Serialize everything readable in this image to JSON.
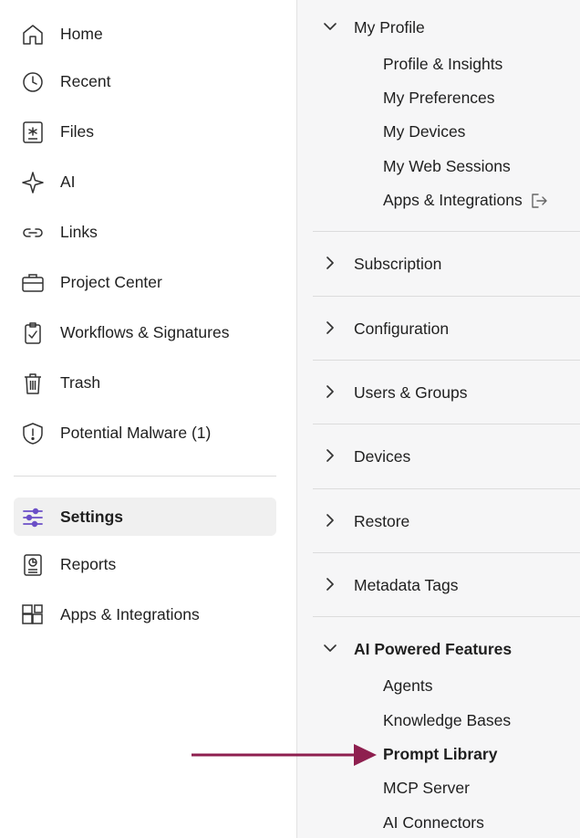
{
  "sidebar": {
    "items": [
      {
        "label": "Home",
        "icon": "home-icon"
      },
      {
        "label": "Recent",
        "icon": "clock-icon"
      },
      {
        "label": "Files",
        "icon": "files-icon"
      },
      {
        "label": "AI",
        "icon": "sparkle-icon"
      },
      {
        "label": "Links",
        "icon": "link-icon"
      },
      {
        "label": "Project Center",
        "icon": "briefcase-icon"
      },
      {
        "label": "Workflows & Signatures",
        "icon": "clipboard-check-icon"
      },
      {
        "label": "Trash",
        "icon": "trash-icon"
      },
      {
        "label": "Potential Malware (1)",
        "icon": "shield-alert-icon"
      }
    ],
    "bottom_items": [
      {
        "label": "Settings",
        "icon": "sliders-icon",
        "active": true
      },
      {
        "label": "Reports",
        "icon": "report-icon"
      },
      {
        "label": "Apps & Integrations",
        "icon": "apps-icon"
      }
    ]
  },
  "settings_menu": {
    "sections": [
      {
        "title": "My Profile",
        "expanded": true,
        "items": [
          "Profile & Insights",
          "My Preferences",
          "My Devices",
          "My Web Sessions",
          "Apps & Integrations"
        ]
      },
      {
        "title": "Subscription",
        "expanded": false
      },
      {
        "title": "Configuration",
        "expanded": false
      },
      {
        "title": "Users & Groups",
        "expanded": false
      },
      {
        "title": "Devices",
        "expanded": false
      },
      {
        "title": "Restore",
        "expanded": false
      },
      {
        "title": "Metadata Tags",
        "expanded": false
      },
      {
        "title": "AI Powered Features",
        "expanded": true,
        "items": [
          "Agents",
          "Knowledge Bases",
          "Prompt Library",
          "MCP Server",
          "AI Connectors"
        ],
        "highlighted_item": "Prompt Library"
      }
    ]
  },
  "colors": {
    "accent": "#6b4fc7",
    "arrow": "#8e1f4f",
    "active_bg": "#f0f0f0",
    "panel_bg": "#f6f6f7"
  }
}
